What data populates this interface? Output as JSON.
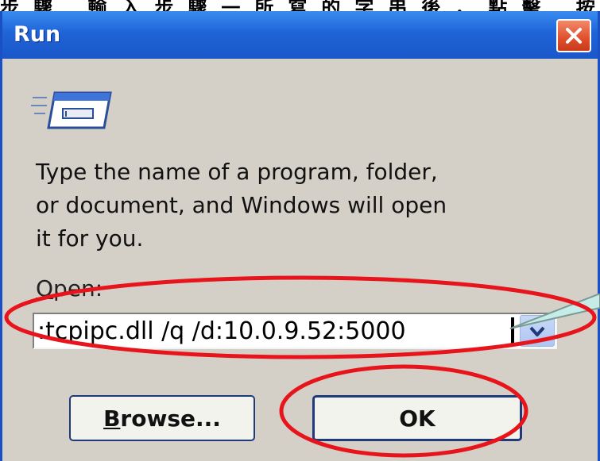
{
  "top_caption": "步驟 輸入步驟一所寫的字串後，點擊 按鈕",
  "window": {
    "title": "Run",
    "close_label": "×"
  },
  "description": "Type the name of a program, folder,\nor document, and Windows will open\nit for you.",
  "open_field": {
    "label_mnemonic": "O",
    "label_rest": "pen:",
    "value": ":tcpipc.dll /q /d:10.0.9.52:5000"
  },
  "buttons": {
    "browse_mnemonic": "B",
    "browse_rest": "rowse...",
    "ok": "OK"
  },
  "colors": {
    "titlebar": "#1f64d8",
    "dialog_bg": "#d4d0c8",
    "highlight": "#e8141b",
    "callout": "#c6ece7"
  },
  "icons": [
    "run-program-icon",
    "close-icon",
    "dropdown-arrow-icon"
  ]
}
